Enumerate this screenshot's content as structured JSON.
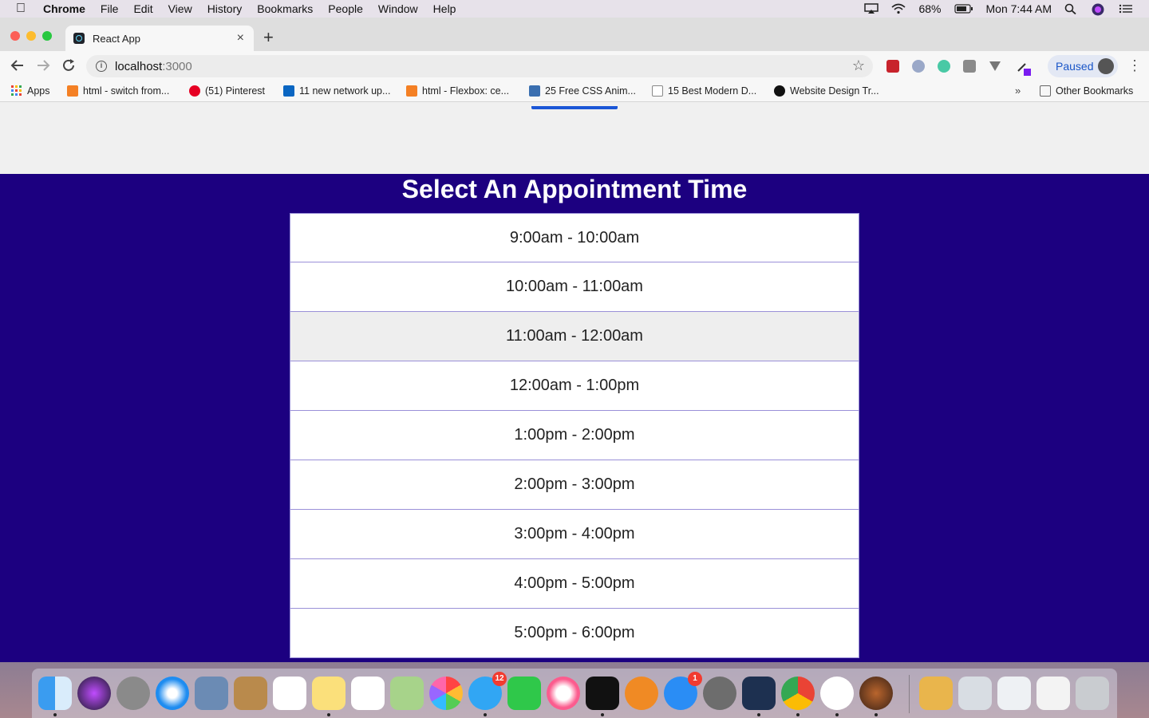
{
  "menubar": {
    "app_name": "Chrome",
    "items": [
      "File",
      "Edit",
      "View",
      "History",
      "Bookmarks",
      "People",
      "Window",
      "Help"
    ],
    "battery": "68%",
    "clock": "Mon 7:44 AM"
  },
  "browser": {
    "tab_title": "React App",
    "new_tab_label": "+",
    "close_label": "×",
    "url_host": "localhost",
    "url_port": ":3000",
    "profile_status": "Paused"
  },
  "bookmarks": {
    "items": [
      {
        "label": "Apps",
        "icon": "apps-grid-icon"
      },
      {
        "label": "html - switch from...",
        "icon": "stackoverflow-icon"
      },
      {
        "label": "(51) Pinterest",
        "icon": "pinterest-icon"
      },
      {
        "label": "11 new network up...",
        "icon": "linkedin-icon"
      },
      {
        "label": "html - Flexbox: ce...",
        "icon": "stackoverflow-icon"
      },
      {
        "label": "25 Free CSS Anim...",
        "icon": "bo-icon"
      },
      {
        "label": "15 Best Modern D...",
        "icon": "page-icon"
      },
      {
        "label": "Website Design Tr...",
        "icon": "medium-icon"
      }
    ],
    "more_label": "»",
    "other_label": "Other Bookmarks"
  },
  "page": {
    "heading": "Select An Appointment Time",
    "slots": [
      "9:00am - 10:00am",
      "10:00am - 11:00am",
      "11:00am - 12:00am",
      "12:00am - 1:00pm",
      "1:00pm - 2:00pm",
      "2:00pm - 3:00pm",
      "3:00pm - 4:00pm",
      "4:00pm - 5:00pm",
      "5:00pm - 6:00pm"
    ],
    "hovered_slot_index": 2
  },
  "dock": {
    "messages_badge": "12",
    "appstore_badge": "1"
  },
  "colors": {
    "page_background": "#1c0080",
    "slot_border": "#9a90d8",
    "slot_hover": "#eeeeee"
  }
}
